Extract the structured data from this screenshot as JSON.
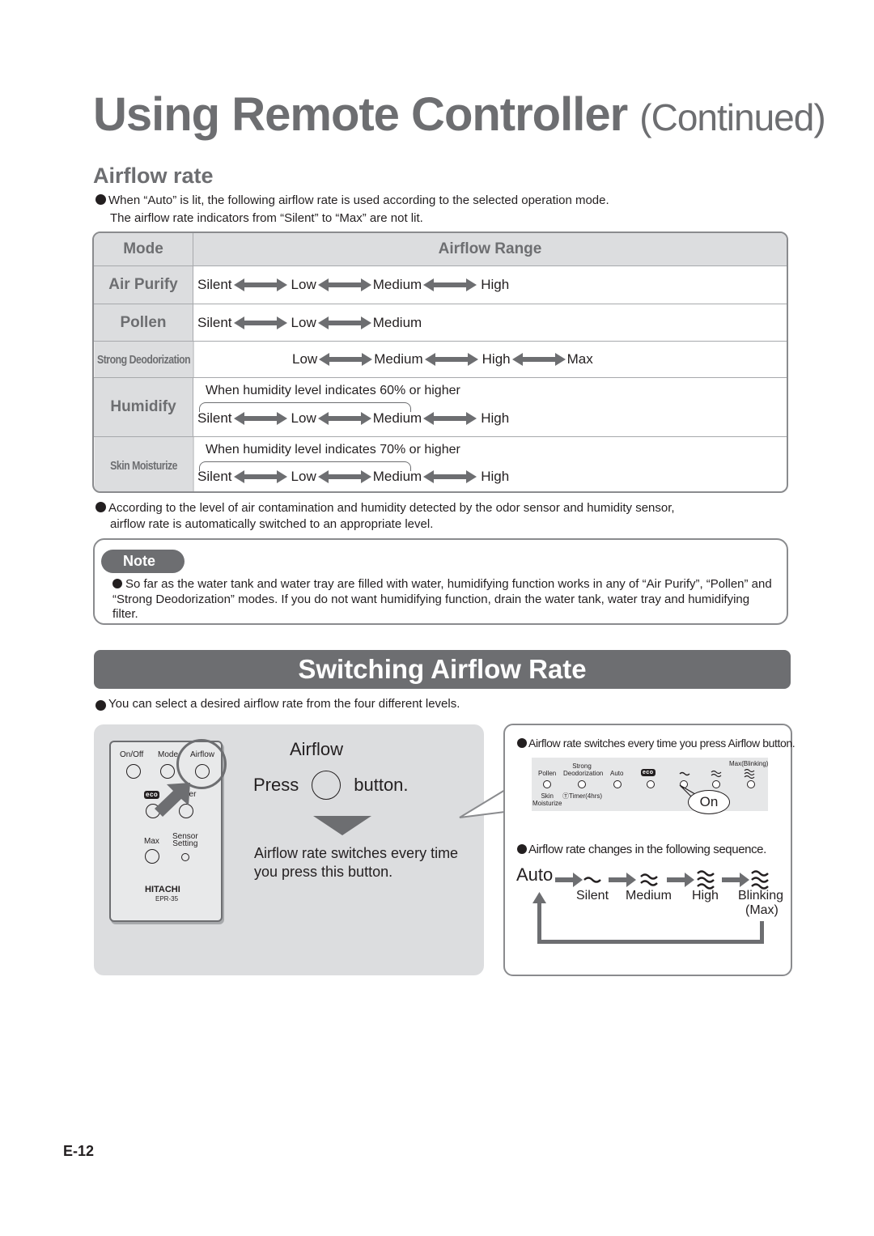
{
  "page": {
    "title": "Using Remote Controller",
    "title_suffix": "(Continued)",
    "page_number": "E-12"
  },
  "airflow_rate": {
    "heading": "Airflow rate",
    "intro_line1": "When “Auto” is lit, the following airflow rate is used according to the selected operation mode.",
    "intro_line2": "The airflow rate indicators from “Silent” to “Max” are not lit.",
    "table": {
      "col_mode": "Mode",
      "col_range": "Airflow Range",
      "rows": [
        {
          "mode": "Air Purify",
          "levels": [
            "Silent",
            "Low",
            "Medium",
            "High"
          ],
          "condition": ""
        },
        {
          "mode": "Pollen",
          "levels": [
            "Silent",
            "Low",
            "Medium"
          ],
          "condition": ""
        },
        {
          "mode": "Strong Deodorization",
          "levels": [
            "Low",
            "Medium",
            "High",
            "Max"
          ],
          "condition": ""
        },
        {
          "mode": "Humidify",
          "levels": [
            "Silent",
            "Low",
            "Medium",
            "High"
          ],
          "condition": "When humidity level indicates 60% or higher"
        },
        {
          "mode": "Skin Moisturize",
          "levels": [
            "Silent",
            "Low",
            "Medium",
            "High"
          ],
          "condition": "When humidity level indicates 70% or higher"
        }
      ]
    },
    "after_line1": "According to the level of air contamination and humidity detected by the odor sensor and humidity sensor,",
    "after_line2": "airflow rate is automatically switched to an appropriate level."
  },
  "note": {
    "badge": "Note",
    "text": "So far as the water tank and water tray are filled with water, humidifying function works in any of “Air Purify”, “Pollen” and “Strong Deodorization” modes. If you do not want humidifying function, drain the water tank, water tray and humidifying filter."
  },
  "switching": {
    "banner": "Switching Airflow Rate",
    "intro": "You can select a desired airflow rate from the four different levels.",
    "remote": {
      "labels": {
        "onoff": "On/Off",
        "mode": "Mode",
        "airflow": "Airflow",
        "eco": "eco",
        "timer": "ner",
        "max": "Max",
        "sensor1": "Sensor",
        "sensor2": "Setting",
        "brand": "HITACHI",
        "model": "EPR-35"
      }
    },
    "step": {
      "button_name": "Airflow",
      "press": "Press",
      "button_word": "button.",
      "description": "Airflow rate switches every time you press this button."
    },
    "indicator": {
      "caption": "Airflow rate switches every time you press Airflow button.",
      "labels": {
        "pollen": "Pollen",
        "strong1": "Strong",
        "strong2": "Deodorization",
        "auto": "Auto",
        "eco": "eco",
        "max_blinking": "Max(Blinking)",
        "skin1": "Skin",
        "skin2": "Moisturize",
        "timer": "ⓉTimer(4hrs)"
      },
      "on_label": "On"
    },
    "sequence": {
      "caption": "Airflow rate changes in the following sequence.",
      "start": "Auto",
      "steps": [
        "Silent",
        "Medium",
        "High",
        "Blinking"
      ],
      "max_note": "(Max)"
    }
  }
}
